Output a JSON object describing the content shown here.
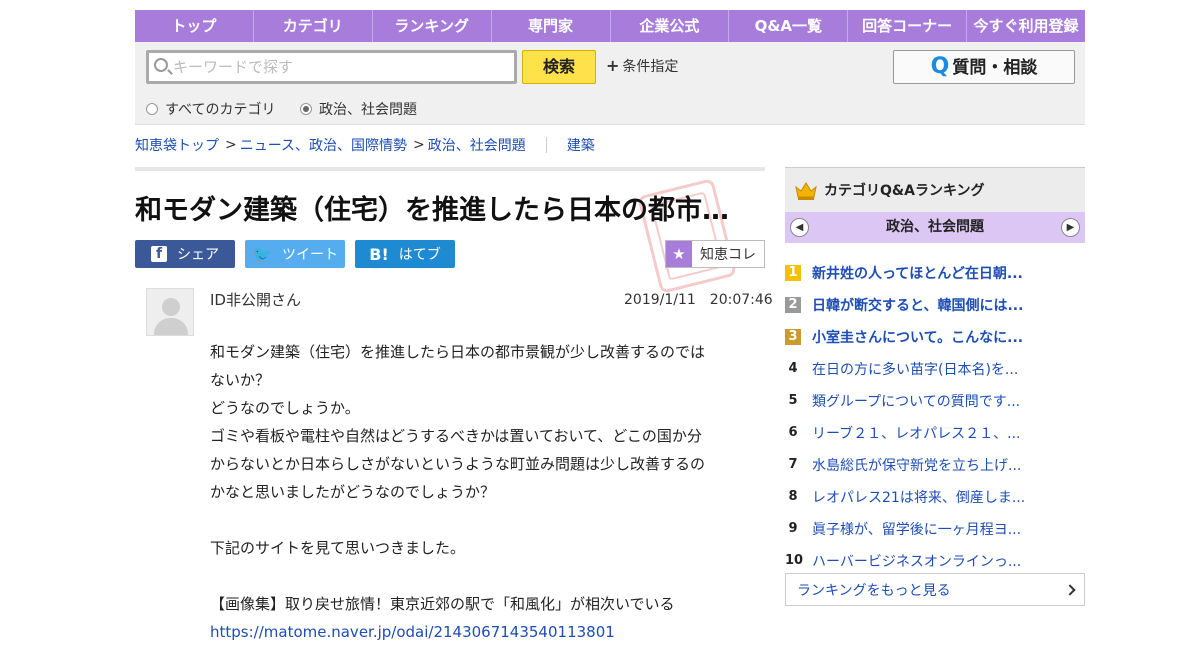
{
  "nav": {
    "items": [
      "トップ",
      "カテゴリ",
      "ランキング",
      "専門家",
      "企業公式",
      "Q&A一覧",
      "回答コーナー",
      "今すぐ利用登録"
    ]
  },
  "search": {
    "placeholder": "キーワードで探す",
    "button_label": "検索",
    "condition_label": "条件指定",
    "ask_button_label": "質問・相談",
    "radio_all": "すべてのカテゴリ",
    "radio_current": "政治、社会問題"
  },
  "breadcrumb": {
    "items": [
      "知恵袋トップ",
      "ニュース、政治、国際情勢",
      "政治、社会問題"
    ],
    "tag": "建築"
  },
  "question": {
    "title": "和モダン建築（住宅）を推進したら日本の都市…",
    "share": {
      "facebook": "シェア",
      "twitter": "ツイート",
      "hatena": "はてブ"
    },
    "chiekore": "知恵コレ",
    "user": "ID非公開さん",
    "date": "2019/1/11　20:07:46",
    "body_lines": [
      "和モダン建築（住宅）を推進したら日本の都市景観が少し改善するのでは",
      "ないか？",
      "どうなのでしょうか。",
      "ゴミや看板や電柱や自然はどうするべきかは置いておいて、どこの国か分",
      "からないとか日本らしさがないというような町並み問題は少し改善するの",
      "かなと思いましたがどうなのでしょうか？",
      "",
      "下記のサイトを見て思いつきました。",
      "",
      "【画像集】取り戻せ旅情！東京近郊の駅で「和風化」が相次いでいる"
    ],
    "link": "https://matome.naver.jp/odai/2143067143540113801"
  },
  "ranking": {
    "title": "カテゴリQ&Aランキング",
    "category": "政治、社会問題",
    "items": [
      {
        "rank": "1",
        "text": "新井姓の人ってほとんど在日朝..."
      },
      {
        "rank": "2",
        "text": "日韓が断交すると、韓国側には..."
      },
      {
        "rank": "3",
        "text": "小室圭さんについて。こんなに..."
      },
      {
        "rank": "4",
        "text": "在日の方に多い苗字(日本名)を..."
      },
      {
        "rank": "5",
        "text": "類グループについての質問です..."
      },
      {
        "rank": "6",
        "text": "リーブ２１、レオパレス２１、..."
      },
      {
        "rank": "7",
        "text": "水島総氏が保守新党を立ち上げ..."
      },
      {
        "rank": "8",
        "text": "レオパレス21は将来、倒産しま..."
      },
      {
        "rank": "9",
        "text": "眞子様が、留学後に一ヶ月程ヨ..."
      },
      {
        "rank": "10",
        "text": "ハーバービジネスオンラインっ..."
      }
    ],
    "more": "ランキングをもっと見る"
  },
  "colors": {
    "nav": "#a77cdb",
    "search_button": "#ffe14a",
    "link": "#1d4db5",
    "rank1": "#f2c200",
    "rank2": "#9a9a9a",
    "rank3": "#c99a2e",
    "facebook": "#3b5998",
    "twitter": "#55acee",
    "hatena": "#1e8ad1"
  }
}
